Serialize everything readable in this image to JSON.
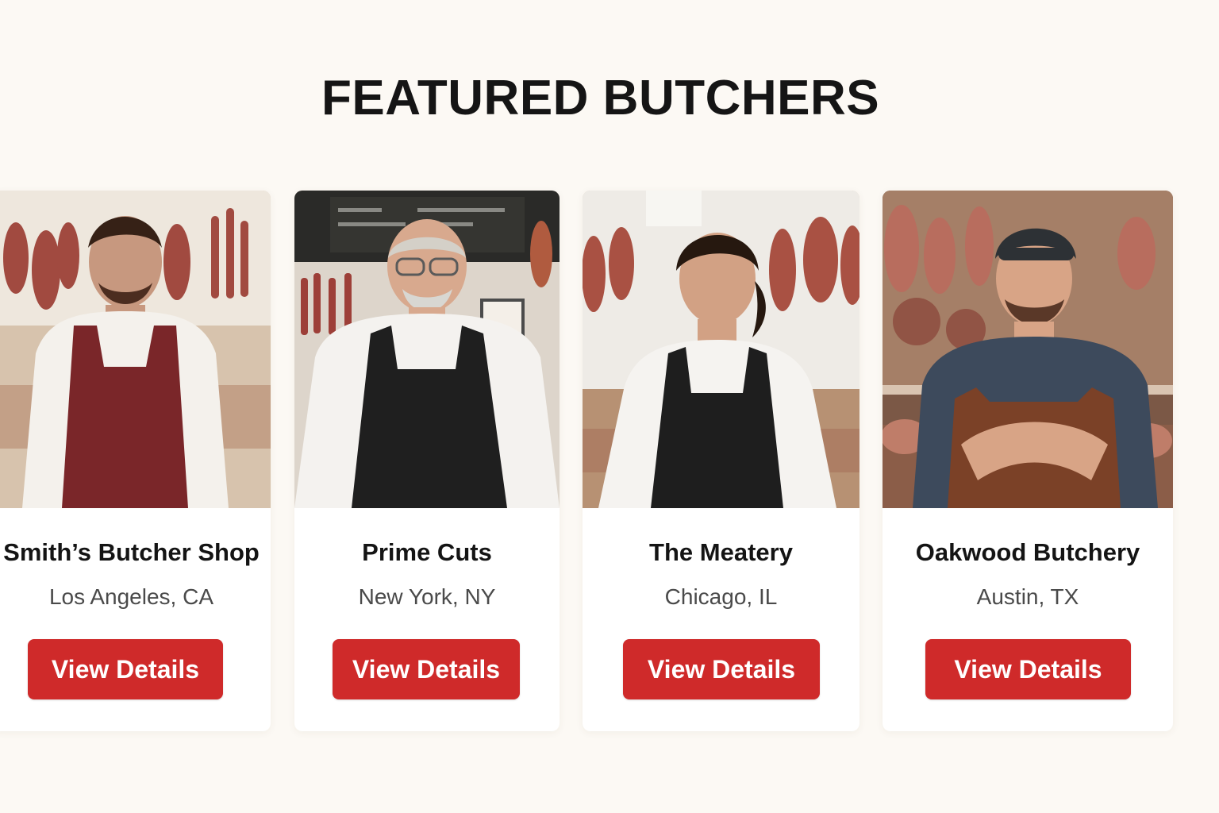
{
  "section": {
    "title": "FEATURED BUTCHERS"
  },
  "butchers": [
    {
      "name": "Smith’s Butcher Shop",
      "location": "Los Angeles, CA",
      "button_label": "View Details",
      "apron_color": "#7a2629",
      "shirt_color": "#f4f1ec"
    },
    {
      "name": "Prime Cuts",
      "location": "New York, NY",
      "button_label": "View Details",
      "apron_color": "#1f1f1f",
      "shirt_color": "#f4f2ef"
    },
    {
      "name": "The Meatery",
      "location": "Chicago, IL",
      "button_label": "View Details",
      "apron_color": "#1e1e1e",
      "shirt_color": "#f5f3f0"
    },
    {
      "name": "Oakwood Butchery",
      "location": "Austin, TX",
      "button_label": "View Details",
      "apron_color": "#7b4127",
      "shirt_color": "#3d4a5c"
    }
  ],
  "colors": {
    "page_background": "#fcf9f4",
    "card_background": "#ffffff",
    "button_background": "#cf2a2a",
    "button_text": "#ffffff",
    "title_text": "#151515",
    "location_text": "#4a4a4a"
  }
}
